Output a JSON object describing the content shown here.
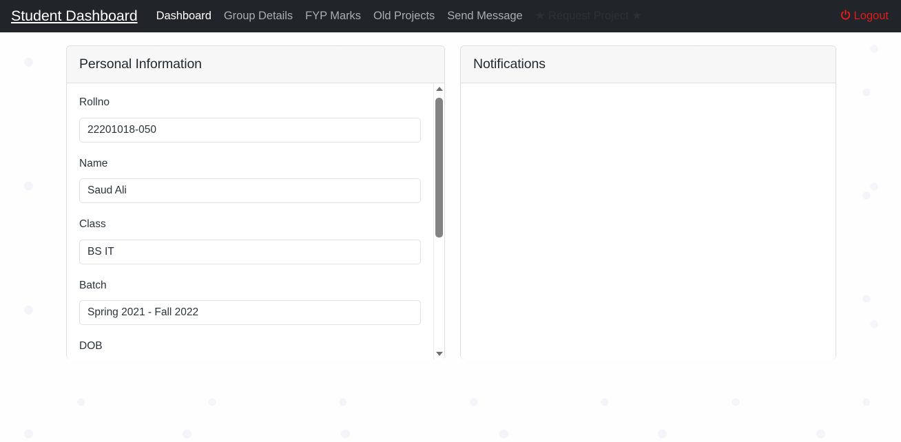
{
  "navbar": {
    "brand": "Student Dashboard",
    "links": [
      {
        "label": "Dashboard",
        "state": "active"
      },
      {
        "label": "Group Details",
        "state": "normal"
      },
      {
        "label": "FYP Marks",
        "state": "normal"
      },
      {
        "label": "Old Projects",
        "state": "normal"
      },
      {
        "label": "Send Message",
        "state": "normal"
      },
      {
        "label": "★ Request Project ★",
        "state": "muted"
      }
    ],
    "logout_label": "Logout",
    "logout_icon": "power-icon",
    "bg_color": "#212529",
    "active_color": "#ffffff",
    "link_color": "#a9adb1",
    "logout_color": "#e01b1b"
  },
  "personal_card": {
    "title": "Personal Information",
    "fields": [
      {
        "label": "Rollno",
        "value": "22201018-050"
      },
      {
        "label": "Name",
        "value": "Saud Ali"
      },
      {
        "label": "Class",
        "value": "BS IT"
      },
      {
        "label": "Batch",
        "value": "Spring 2021 - Fall 2022"
      },
      {
        "label": "DOB",
        "value": ""
      }
    ],
    "scrollbar": {
      "up_arrow_icon": "chevron-up-icon",
      "down_arrow_icon": "chevron-down-icon",
      "thumb_color": "#838383"
    }
  },
  "notifications_card": {
    "title": "Notifications",
    "items": []
  }
}
